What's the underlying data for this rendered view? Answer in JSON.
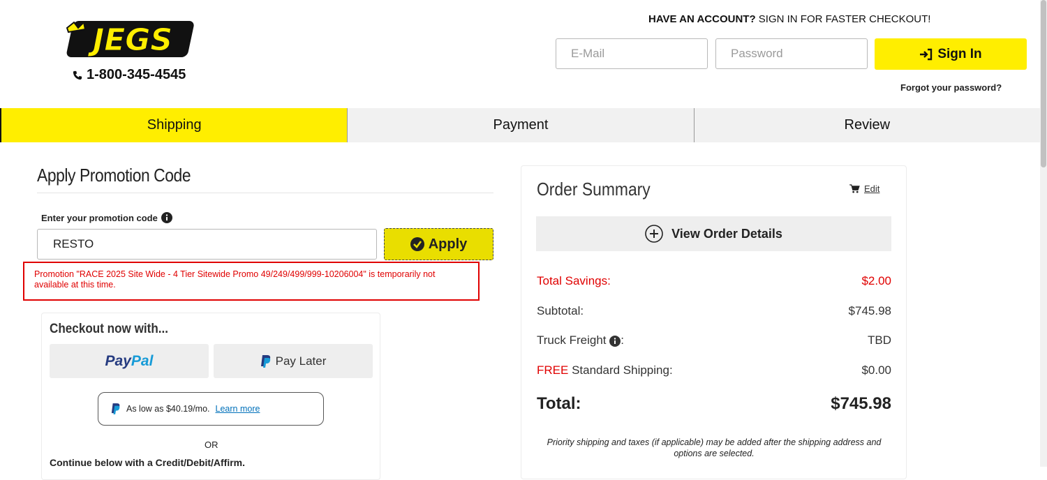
{
  "header": {
    "logo_text": "JEGS",
    "phone": "1-800-345-4545",
    "account_prompt_bold": "HAVE AN ACCOUNT?",
    "account_prompt_rest": " SIGN IN FOR FASTER CHECKOUT!",
    "email_placeholder": "E-Mail",
    "password_placeholder": "Password",
    "sign_in_label": "Sign In",
    "forgot_password": "Forgot your password?"
  },
  "steps": [
    {
      "label": "Shipping",
      "active": true
    },
    {
      "label": "Payment",
      "active": false
    },
    {
      "label": "Review",
      "active": false
    }
  ],
  "promo": {
    "title": "Apply Promotion Code",
    "label": "Enter your promotion code",
    "code_value": "RESTO",
    "apply_label": "Apply",
    "error": "Promotion \"RACE 2025 Site Wide - 4 Tier Sitewide Promo 49/249/499/999-10206004\" is temporarily not available at this time."
  },
  "checkout": {
    "title": "Checkout now with...",
    "paypal_pay": "Pay",
    "paypal_pal": "Pal",
    "pay_later": "Pay Later",
    "as_low_as": "As low as $40.19/mo.",
    "learn_more": "Learn more",
    "or": "OR",
    "continue": "Continue below with a Credit/Debit/Affirm."
  },
  "summary": {
    "title": "Order Summary",
    "edit": "Edit",
    "view_details": "View Order Details",
    "savings_label": "Total Savings:",
    "savings_value": "$2.00",
    "subtotal_label": "Subtotal:",
    "subtotal_value": "$745.98",
    "freight_label": "Truck Freight",
    "freight_colon": ":",
    "freight_value": "TBD",
    "shipping_free": "FREE",
    "shipping_label": " Standard Shipping:",
    "shipping_value": "$0.00",
    "total_label": "Total:",
    "total_value": "$745.98",
    "note": "Priority shipping and taxes (if applicable) may be added after the shipping address and options are selected."
  },
  "colors": {
    "brand_yellow": "#ffee00",
    "error_red": "#e00000"
  }
}
